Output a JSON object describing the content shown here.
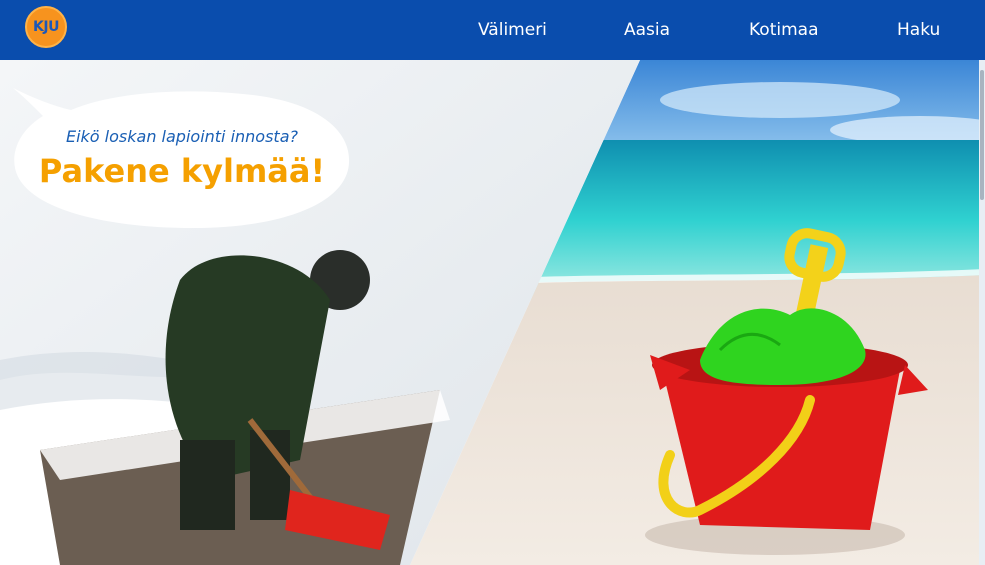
{
  "header": {
    "logo_text": "KJU",
    "nav": [
      {
        "label": "Välimeri"
      },
      {
        "label": "Aasia"
      },
      {
        "label": "Kotimaa"
      },
      {
        "label": "Haku"
      }
    ]
  },
  "hero": {
    "bubble_subtitle": "Eikö loskan lapiointi innosta?",
    "bubble_title": "Pakene kylmää!"
  },
  "colors": {
    "header_bg": "#0a4dad",
    "logo_orange": "#f7931e",
    "subtitle_blue": "#1a5fb4",
    "title_orange": "#f5a000"
  }
}
